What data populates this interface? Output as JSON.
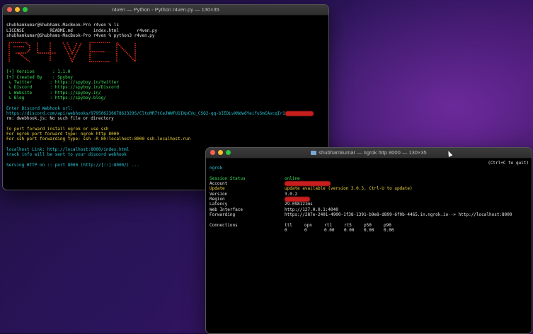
{
  "colors": {
    "green": "#3be05a",
    "cyan": "#27c6d6",
    "yellow": "#f2d43a",
    "red": "#ff3b3b",
    "ascii_red": "#e0301c"
  },
  "win1": {
    "title": "r4ven — Python ◦ Python r4ven.py — 130×35",
    "lines": {
      "l1": "shubhamkumar@Shubhams-MacBook-Pro r4ven % ls",
      "l2": "LICENSE          README.md        index.html       r4ven.py",
      "l3": "shubhamkumar@Shubhams-MacBook-Pro r4ven % python3 r4ven.py",
      "version": "[+] Version       : 1.1.0",
      "created": "[+] Created By    : Spyboy",
      "twitter": " ↳ Twitter       : https://spyboy.in/twitter",
      "discord": " ↳ Discord       : https://spyboy.in/Discord",
      "website": " ↳ Website       : https://spyboy.in/",
      "blog": " ↳ Blog          : https://spyboy.blog/",
      "enter_hook": "Enter Discord Webhook url:",
      "hook_url": "https://discord.com/api/webhooks/97950623667862329S/CltcMR7tCeJWWfU1IXpCVu_CSQ2-qq-bIEDLvXNdw6YeifuSmCAvcqIr1",
      "rm": "rm: dwebhook.js: No such file or directory",
      "pf1": "To port forward install ngrok or use ssh",
      "pf2": "For ngrok port forward type: ngrok http 8000",
      "pf3": "For ssh port forwarding type: ssh -R 80:localhost:8000 ssh.localhost.run",
      "local": "localhost Link: http://localhost:8000/index.html",
      "track": "track info will be sent to your discord webhook",
      "serving": "Serving HTTP on :: port 8000 (http://[::]:8000/) ..."
    }
  },
  "win2": {
    "title": "shubhamkumar — ngrok http 8000 — 130×35",
    "app": "ngrok",
    "quit_hint": "(Ctrl+C to quit)",
    "rows": [
      {
        "key": "Session Status",
        "val": "online"
      },
      {
        "key": "Account",
        "val": ""
      },
      {
        "key": "Update",
        "val": "update available (version 3.0.3, Ctrl-U to update)"
      },
      {
        "key": "Version",
        "val": "3.0.2"
      },
      {
        "key": "Region",
        "val": ""
      },
      {
        "key": "Latency",
        "val": "29.098121ms"
      },
      {
        "key": "Web Interface",
        "val": "http://127.0.0.1:4040"
      },
      {
        "key": "Forwarding",
        "val": "https://287e-2401-4900-1f38-1391-b9e8-d899-6f0b-4465.in.ngrok.io -> http://localhost:8000"
      }
    ],
    "connections": {
      "label": "Connections",
      "headers": [
        "ttl",
        "opn",
        "rt1",
        "rt5",
        "p50",
        "p90"
      ],
      "values": [
        "0",
        "0",
        "0.00",
        "0.00",
        "0.00",
        "0.00"
      ]
    }
  }
}
